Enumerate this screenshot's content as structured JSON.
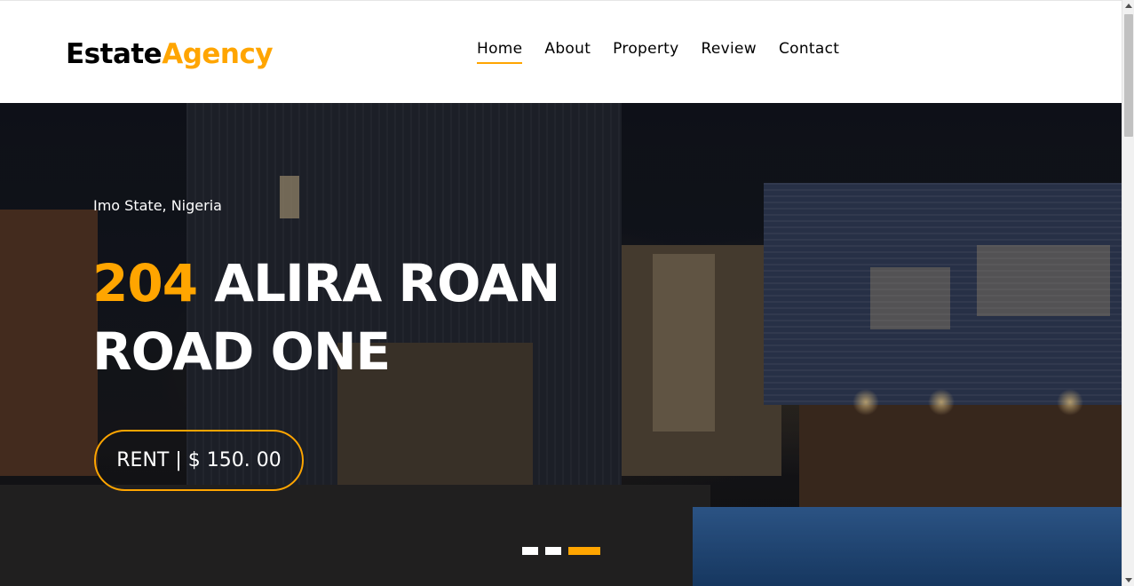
{
  "brand": {
    "part1": "Estate",
    "part2": "Agency",
    "accent_color": "#ffa500"
  },
  "nav": {
    "items": [
      {
        "label": "Home",
        "active": true
      },
      {
        "label": "About",
        "active": false
      },
      {
        "label": "Property",
        "active": false
      },
      {
        "label": "Review",
        "active": false
      },
      {
        "label": "Contact",
        "active": false
      }
    ]
  },
  "hero": {
    "location": "Imo State, Nigeria",
    "title_number": "204",
    "title_rest": "ALIRA ROAN ROAD ONE",
    "price": "RENT | $ 150. 00",
    "carousel": {
      "slides": 3,
      "active_index": 2
    }
  }
}
